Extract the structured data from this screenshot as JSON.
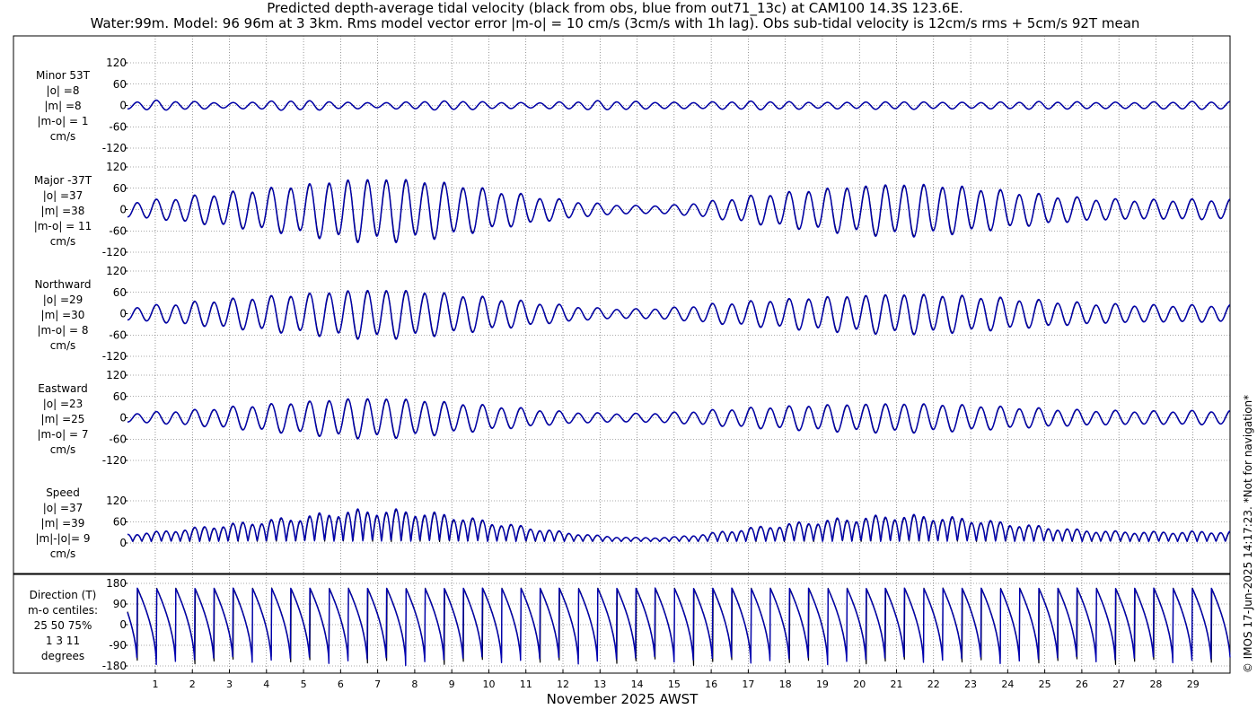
{
  "header": {
    "title_line1": "Predicted depth-average tidal velocity (black from obs, blue from out71_13c) at CAM100 14.3S 123.6E.",
    "title_line2": "Water:99m. Model: 96 96m at 3 3km. Rms model vector error |m-o| = 10 cm/s (3cm/s with 1h lag). Obs sub-tidal velocity is 12cm/s rms + 5cm/s 92T mean"
  },
  "side_note": "© IMOS 17-Jun-2025 14:17:23. *Not for navigation*",
  "colors": {
    "obs": "#000000",
    "model": "#0000b0",
    "grid": "#555555"
  },
  "chart_data": {
    "type": "line",
    "xlabel": "November 2025 AWST",
    "x_ticks": [
      "1",
      "2",
      "3",
      "4",
      "5",
      "6",
      "7",
      "8",
      "9",
      "10",
      "11",
      "12",
      "13",
      "14",
      "15",
      "16",
      "17",
      "18",
      "19",
      "20",
      "21",
      "22",
      "23",
      "24",
      "25",
      "26",
      "27",
      "28",
      "29"
    ],
    "xlim": [
      0.25,
      30.0
    ],
    "series_names": [
      "obs",
      "out71_13c"
    ],
    "panels": [
      {
        "id": "minor",
        "label": [
          "Minor 53T",
          "|o| =8",
          "|m| =8",
          "|m-o| = 1",
          "cm/s"
        ],
        "ylim": [
          -120,
          120
        ],
        "yticks": [
          "120",
          "60",
          "0",
          "-60",
          "-120"
        ],
        "ytick_values": [
          120,
          60,
          0,
          -60,
          -120
        ],
        "kind": "signed",
        "amp_env": [
          8,
          13,
          10,
          7,
          11,
          13,
          9,
          7,
          10,
          12,
          9,
          7,
          9,
          12,
          10,
          8,
          9,
          11,
          10,
          8,
          9,
          10,
          9,
          8,
          9,
          10,
          9,
          8,
          9,
          10
        ]
      },
      {
        "id": "major",
        "label": [
          "Major -37T",
          "|o| =37",
          "|m| =38",
          "|m-o| = 11",
          "cm/s"
        ],
        "ylim": [
          -120,
          120
        ],
        "yticks": [
          "120",
          "60",
          "0",
          "-60",
          "-120"
        ],
        "ytick_values": [
          120,
          60,
          0,
          -60,
          -120
        ],
        "kind": "signed",
        "amp_env": [
          18,
          25,
          35,
          45,
          55,
          65,
          78,
          82,
          78,
          68,
          52,
          38,
          25,
          15,
          10,
          12,
          22,
          35,
          45,
          55,
          62,
          68,
          65,
          58,
          48,
          38,
          30,
          26,
          25,
          26
        ]
      },
      {
        "id": "north",
        "label": [
          "Northward",
          "|o| =29",
          "|m| =30",
          "|m-o| = 8",
          "cm/s"
        ],
        "ylim": [
          -120,
          120
        ],
        "yticks": [
          "120",
          "60",
          "0",
          "-60",
          "-120"
        ],
        "ytick_values": [
          120,
          60,
          0,
          -60,
          -120
        ],
        "kind": "signed",
        "amp_env": [
          15,
          22,
          30,
          38,
          45,
          52,
          60,
          64,
          60,
          52,
          42,
          32,
          22,
          14,
          12,
          16,
          25,
          32,
          38,
          44,
          48,
          52,
          50,
          46,
          40,
          34,
          28,
          24,
          22,
          22
        ]
      },
      {
        "id": "east",
        "label": [
          "Eastward",
          "|o| =23",
          "|m| =25",
          "|m-o| = 7",
          "cm/s"
        ],
        "ylim": [
          -120,
          120
        ],
        "yticks": [
          "120",
          "60",
          "0",
          "-60",
          "-120"
        ],
        "ytick_values": [
          120,
          60,
          0,
          -60,
          -120
        ],
        "kind": "signed",
        "amp_env": [
          10,
          15,
          20,
          28,
          35,
          42,
          50,
          52,
          48,
          40,
          32,
          24,
          16,
          12,
          11,
          14,
          20,
          26,
          30,
          34,
          36,
          38,
          36,
          33,
          28,
          24,
          20,
          18,
          17,
          18
        ]
      },
      {
        "id": "speed",
        "label": [
          "Speed",
          "|o| =37",
          "|m| =39",
          "|m|-|o|= 9",
          "cm/s"
        ],
        "ylim": [
          0,
          120
        ],
        "yticks": [
          "120",
          "60",
          "0"
        ],
        "ytick_values": [
          120,
          60,
          0
        ],
        "kind": "speed",
        "amp_env": [
          18,
          25,
          35,
          45,
          55,
          65,
          78,
          82,
          78,
          68,
          52,
          38,
          25,
          15,
          10,
          12,
          22,
          35,
          45,
          55,
          62,
          68,
          65,
          58,
          48,
          38,
          30,
          26,
          25,
          26
        ]
      },
      {
        "id": "direction",
        "label": [
          "Direction (T)",
          "m-o centiles:",
          "25  50  75%",
          "1   3   11",
          "degrees"
        ],
        "ylim": [
          -180,
          180
        ],
        "yticks": [
          "180",
          "90",
          "0",
          "-90",
          "-180"
        ],
        "ytick_values": [
          180,
          90,
          0,
          -90,
          -180
        ],
        "kind": "direction",
        "amp_env": []
      }
    ]
  }
}
